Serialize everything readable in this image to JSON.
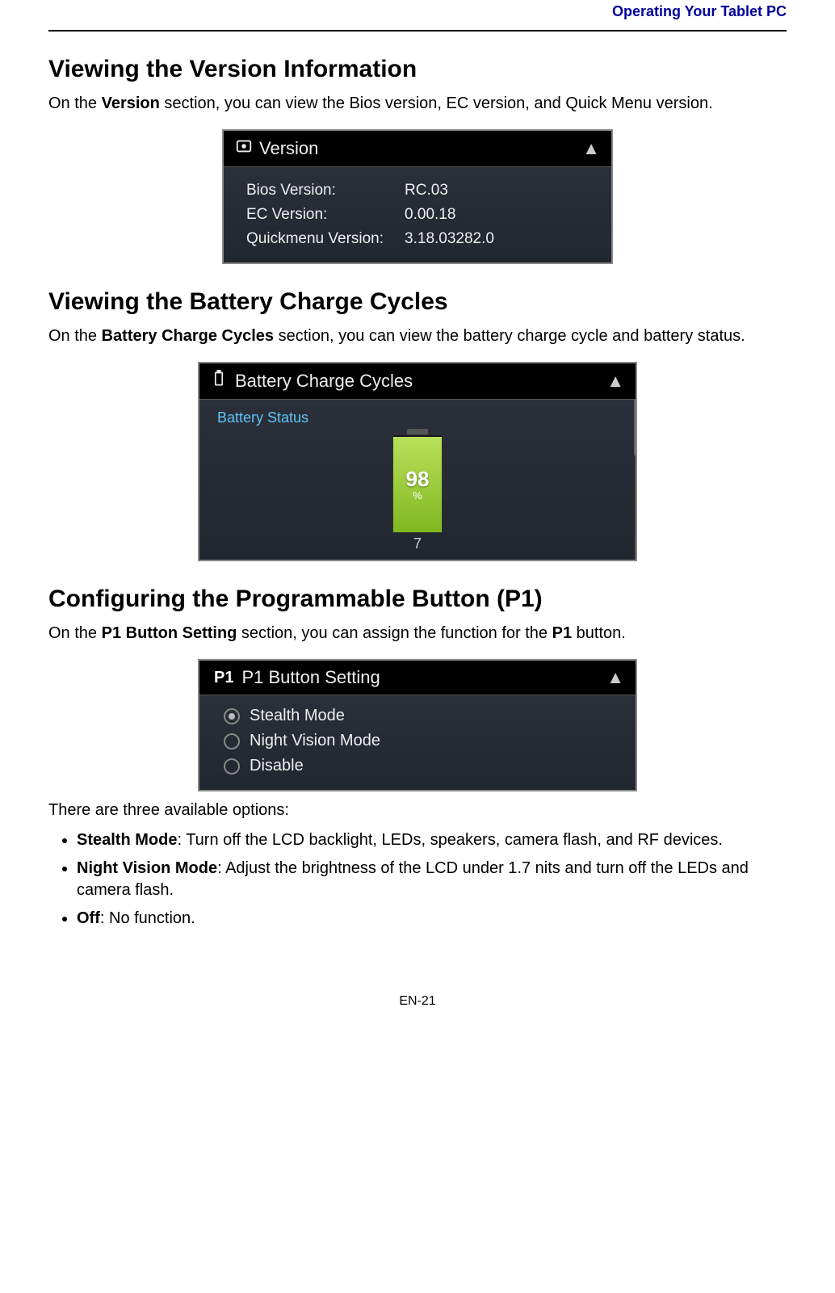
{
  "header": {
    "title": "Operating Your Tablet PC"
  },
  "section1": {
    "heading": "Viewing the Version Information",
    "intro_pre": "On the ",
    "intro_bold": "Version",
    "intro_post": " section, you can view the Bios version, EC version, and Quick Menu version."
  },
  "version_panel": {
    "title": "Version",
    "rows": [
      {
        "label": "Bios Version:",
        "value": "RC.03"
      },
      {
        "label": "EC Version:",
        "value": "0.00.18"
      },
      {
        "label": "Quickmenu Version:",
        "value": "3.18.03282.0"
      }
    ]
  },
  "section2": {
    "heading": "Viewing the Battery Charge Cycles",
    "intro_pre": "On the ",
    "intro_bold": "Battery Charge Cycles",
    "intro_post": " section, you can view the battery charge cycle and battery status."
  },
  "battery_panel": {
    "title": "Battery Charge Cycles",
    "status_label": "Battery Status",
    "percent": "98",
    "percent_sign": "%",
    "cycles": "7",
    "fill_height_pct": 98
  },
  "section3": {
    "heading": "Configuring the Programmable Button (P1)",
    "intro_pre": "On the ",
    "intro_bold": "P1 Button Setting",
    "intro_mid": " section, you can assign the function for the ",
    "intro_bold2": "P1",
    "intro_post": " button."
  },
  "p1_panel": {
    "badge": "P1",
    "title": "P1 Button Setting",
    "options": [
      {
        "label": "Stealth Mode",
        "selected": true
      },
      {
        "label": "Night Vision Mode",
        "selected": false
      },
      {
        "label": "Disable",
        "selected": false
      }
    ]
  },
  "options_intro": "There are three available options:",
  "options_list": [
    {
      "bold": "Stealth Mode",
      "text": ": Turn off the LCD backlight, LEDs, speakers, camera flash, and RF devices."
    },
    {
      "bold": "Night Vision Mode",
      "text": ": Adjust the brightness of the LCD under 1.7 nits and turn off the LEDs and camera flash."
    },
    {
      "bold": "Off",
      "text": ": No function."
    }
  ],
  "page_number": "EN-21"
}
